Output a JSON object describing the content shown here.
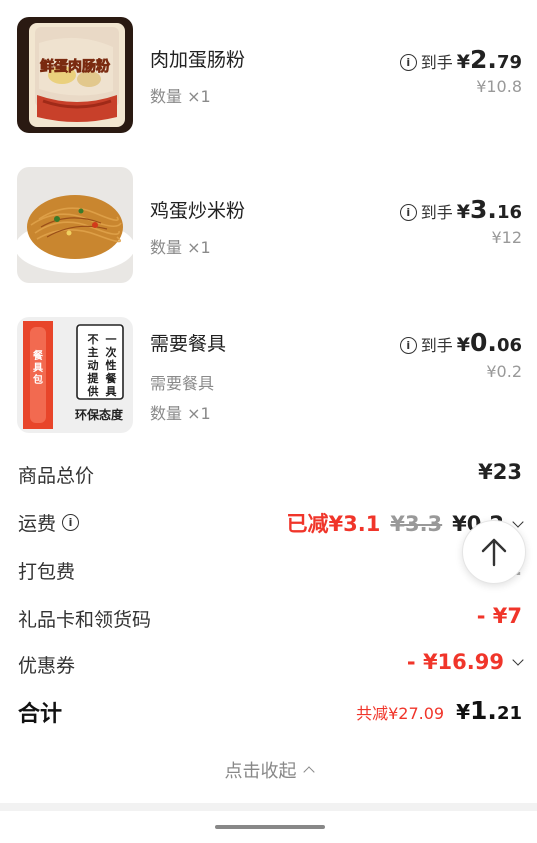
{
  "items": [
    {
      "name": "肉加蛋肠粉",
      "thumb_text": "鲜蛋肉肠粉",
      "qty": "数量 ×1",
      "prefix": "到手",
      "currency": "¥",
      "price_int": "2.",
      "price_dec": "79",
      "original": "¥10.8"
    },
    {
      "name": "鸡蛋炒米粉",
      "qty": "数量 ×1",
      "prefix": "到手",
      "currency": "¥",
      "price_int": "3.",
      "price_dec": "16",
      "original": "¥12"
    },
    {
      "name": "需要餐具",
      "spec": "需要餐具",
      "thumb_lines": [
        "一次性餐具",
        "不主动提供",
        "环保态度",
        "餐具包"
      ],
      "qty": "数量 ×1",
      "prefix": "到手",
      "currency": "¥",
      "price_int": "0.",
      "price_dec": "06",
      "original": "¥0.2"
    }
  ],
  "summary": {
    "goods_total_label": "商品总价",
    "goods_total_value": "¥23",
    "shipping_label": "运费",
    "shipping_discount": "已减¥3.1",
    "shipping_original": "¥3.3",
    "shipping_value": "¥0.2",
    "packing_label": "打包费",
    "packing_value": "¥2",
    "giftcard_label": "礼品卡和领货码",
    "giftcard_value": "- ¥7",
    "coupon_label": "优惠券",
    "coupon_value": "- ¥16.99",
    "total_label": "合计",
    "total_saved": "共减¥27.09",
    "total_currency": "¥",
    "total_int": "1.",
    "total_dec": "21"
  },
  "collapse_label": "点击收起",
  "icons": [
    "info-icon",
    "chevron-down-icon",
    "arrow-up-icon",
    "chevron-up-icon"
  ],
  "colors": {
    "accent_red": "#f0352a",
    "muted": "#999999"
  }
}
